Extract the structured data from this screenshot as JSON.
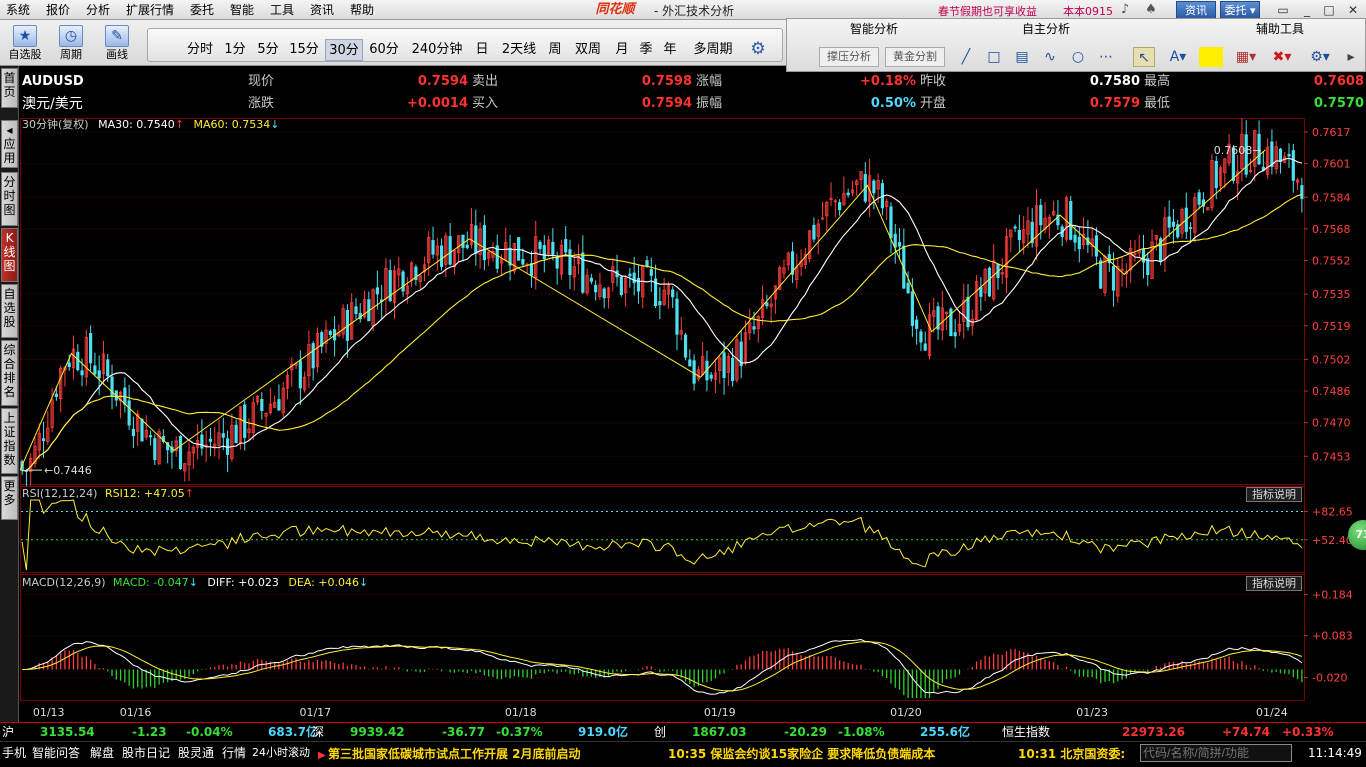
{
  "menu": {
    "items": [
      "系统",
      "报价",
      "分析",
      "扩展行情",
      "委托",
      "智能",
      "工具",
      "资讯",
      "帮助"
    ],
    "brand": "同花顺",
    "title": "- 外汇技术分析",
    "promo": "春节假期也可享收益",
    "version": "本本0915",
    "news_btn": "资讯",
    "trade_btn": "委托"
  },
  "toolbar": {
    "big_buttons": [
      "自选股",
      "周期",
      "画线"
    ],
    "periods": [
      "分时",
      "1分",
      "5分",
      "15分",
      "30分",
      "60分",
      "240分钟",
      "日",
      "2天线",
      "周",
      "双周",
      "月",
      "季",
      "年",
      "多周期"
    ],
    "active_period": "30分"
  },
  "analysis_panel": {
    "smart": "智能分析",
    "self": "自主分析",
    "aux": "辅助工具",
    "support_btn": "撑压分析",
    "golden_btn": "黄金分割",
    "highlight_color": "#ffee00"
  },
  "left_tabs": [
    "首页",
    "应用",
    "分时图",
    "K线图",
    "自选股",
    "综合排名",
    "上证指数",
    "更多"
  ],
  "quote": {
    "symbol": "AUDUSD",
    "name": "澳元/美元",
    "rows": [
      [
        {
          "l": "现价",
          "v": "0.7594",
          "c": "red"
        },
        {
          "l": "卖出",
          "v": "0.7598",
          "c": "red"
        },
        {
          "l": "涨幅",
          "v": "+0.18%",
          "c": "red"
        },
        {
          "l": "昨收",
          "v": "0.7580",
          "c": "white"
        },
        {
          "l": "最高",
          "v": "0.7608",
          "c": "red"
        }
      ],
      [
        {
          "l": "涨跌",
          "v": "+0.0014",
          "c": "red"
        },
        {
          "l": "买入",
          "v": "0.7594",
          "c": "red"
        },
        {
          "l": "振幅",
          "v": "0.50%",
          "c": "cyan"
        },
        {
          "l": "开盘",
          "v": "0.7579",
          "c": "red"
        },
        {
          "l": "最低",
          "v": "0.7570",
          "c": "green"
        }
      ]
    ]
  },
  "indicators": {
    "main": {
      "label": "30分钟(复权)",
      "ma30": "MA30: 0.7540",
      "ma60": "MA60: 0.7534",
      "up_arrow": "↑",
      "down_arrow": "↓"
    },
    "rsi": {
      "label": "RSI(12,12,24)",
      "value": "RSI12: +47.05",
      "arrow": "↑",
      "help": "指标说明",
      "bubble": "73"
    },
    "macd": {
      "label": "MACD(12,26,9)",
      "macd": "MACD: -0.047",
      "diff": "DIFF: +0.023",
      "dea": "DEA: +0.046",
      "arrow": "↓",
      "help": "指标说明"
    }
  },
  "chart_data": {
    "type": "candlestick",
    "price_axis": [
      "0.7617",
      "0.7601",
      "0.7584",
      "0.7568",
      "0.7552",
      "0.7535",
      "0.7519",
      "0.7502",
      "0.7486",
      "0.7470",
      "0.7453"
    ],
    "price_range": [
      0.744,
      0.7617
    ],
    "rsi_axis": [
      "+82.65",
      "+52.40"
    ],
    "macd_axis": [
      "+0.184",
      "+0.083",
      "-0.020"
    ],
    "dates": [
      "01/13",
      "01/16",
      "01/17",
      "01/18",
      "01/19",
      "01/20",
      "01/23",
      "01/24"
    ],
    "low_annotation": "0.7446",
    "high_annotation": "0.7608",
    "pivots": [
      [
        0.0,
        0.7446
      ],
      [
        0.04,
        0.7505
      ],
      [
        0.12,
        0.7456
      ],
      [
        0.35,
        0.756
      ],
      [
        0.5,
        0.7538
      ],
      [
        0.53,
        0.7493
      ],
      [
        0.66,
        0.759
      ],
      [
        0.71,
        0.7516
      ],
      [
        0.81,
        0.7575
      ],
      [
        0.85,
        0.7545
      ],
      [
        0.97,
        0.7608
      ],
      [
        1.0,
        0.7594
      ]
    ],
    "wave_zigzag": [
      [
        0.0,
        0.7446
      ],
      [
        0.04,
        0.7505
      ],
      [
        0.12,
        0.7456
      ],
      [
        0.35,
        0.7563
      ],
      [
        0.53,
        0.7493
      ],
      [
        0.66,
        0.759
      ],
      [
        0.71,
        0.7516
      ],
      [
        0.81,
        0.7575
      ],
      [
        0.86,
        0.7545
      ],
      [
        0.97,
        0.7608
      ]
    ],
    "rsi_range": [
      20,
      95
    ],
    "macd_range": [
      -0.07,
      0.2
    ],
    "colors": {
      "up": "#ff3c3c",
      "down": "#4ce0f0",
      "ma30": "#ffffff",
      "ma60": "#ffee33",
      "rsi": "#ffee33",
      "diff": "#ffffff",
      "dea": "#ffee33",
      "grid": "#7a0000"
    }
  },
  "index_bar": [
    {
      "name": "沪",
      "price": "3135.54",
      "chg": "-1.23",
      "pct": "-0.04%",
      "amt": "683.7亿"
    },
    {
      "name": "深",
      "price": "9939.42",
      "chg": "-36.77",
      "pct": "-0.37%",
      "amt": "919.0亿"
    },
    {
      "name": "创",
      "price": "1867.03",
      "chg": "-20.29",
      "pct": "-1.08%",
      "amt": "255.6亿"
    },
    {
      "name": "恒生指数",
      "price": "22973.26",
      "chg": "+74.74",
      "pct": "+0.33%",
      "amt": ""
    }
  ],
  "news_bar": {
    "tabs": [
      "手机",
      "智能问答",
      "解盘",
      "股市日记",
      "股灵通",
      "行情",
      "24小时滚动"
    ],
    "headlines": [
      "第三批国家低碳城市试点工作开展 2月底前启动",
      "10:35 保监会约谈15家险企 要求降低负债端成本",
      "10:31 北京国资委:"
    ],
    "search_placeholder": "代码/名称/简拼/功能",
    "time": "11:14:49"
  }
}
